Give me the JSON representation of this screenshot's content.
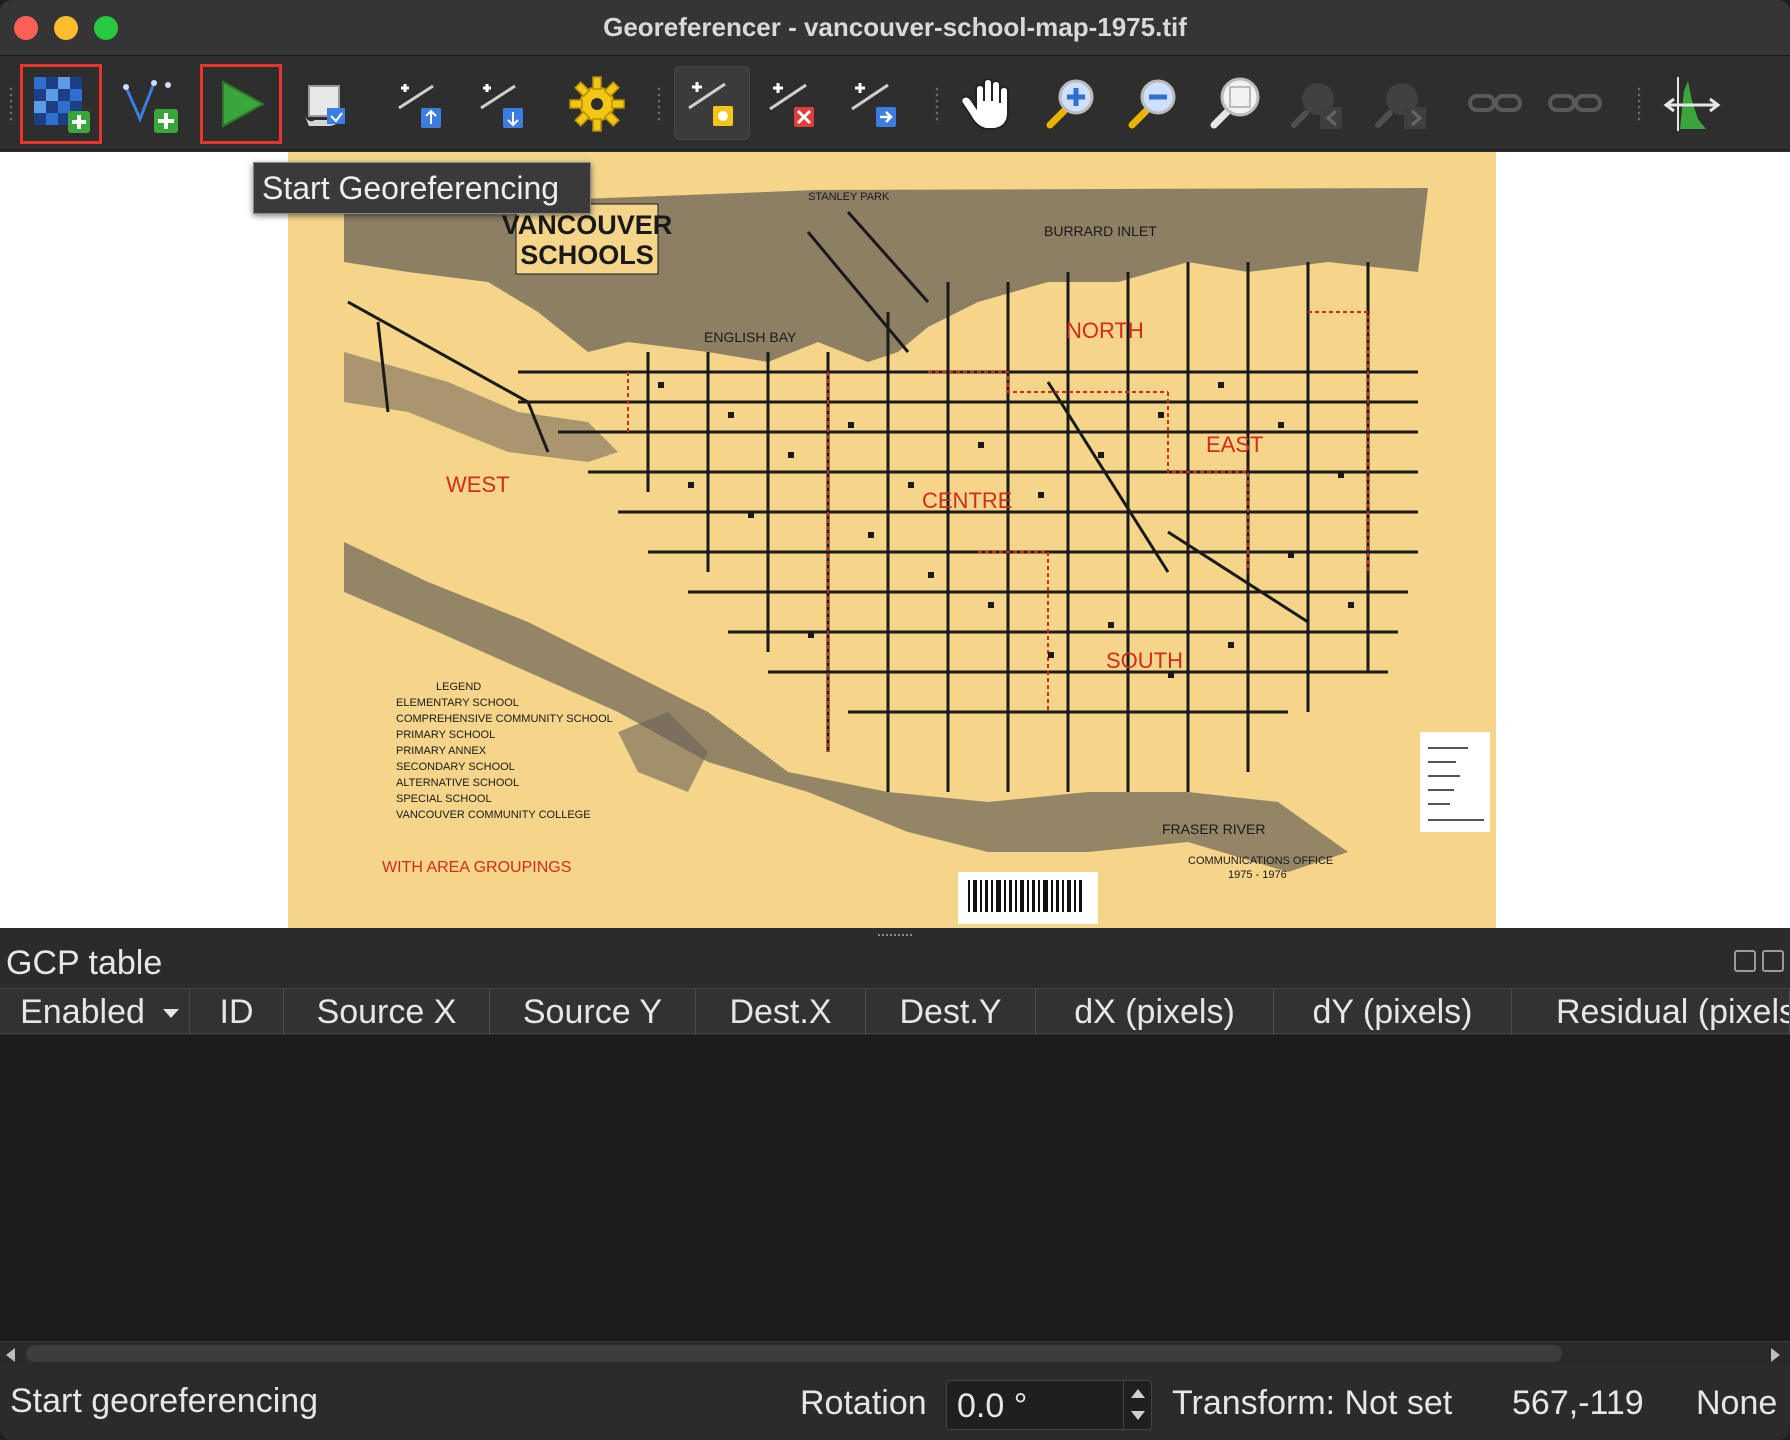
{
  "window": {
    "title": "Georeferencer - vancouver-school-map-1975.tif"
  },
  "toolbar": {
    "buttons": [
      {
        "name": "open-raster",
        "icon": "open-raster-icon",
        "highlighted": true
      },
      {
        "name": "add-vector",
        "icon": "add-vector-icon"
      },
      {
        "name": "start-georeferencing",
        "icon": "play-icon",
        "highlighted": true
      },
      {
        "name": "generate-gdal-script",
        "icon": "script-icon"
      },
      {
        "name": "load-gcp-points",
        "icon": "load-gcp-icon"
      },
      {
        "name": "save-gcp-points",
        "icon": "save-gcp-icon"
      },
      {
        "name": "transformation-settings",
        "icon": "gear-icon"
      },
      {
        "name": "add-point",
        "icon": "add-point-icon",
        "pressed": true
      },
      {
        "name": "delete-point",
        "icon": "delete-point-icon"
      },
      {
        "name": "move-gcp-point",
        "icon": "move-point-icon"
      },
      {
        "name": "pan",
        "icon": "pan-hand-icon"
      },
      {
        "name": "zoom-in",
        "icon": "zoom-in-icon"
      },
      {
        "name": "zoom-out",
        "icon": "zoom-out-icon"
      },
      {
        "name": "zoom-to-layer",
        "icon": "zoom-layer-icon"
      },
      {
        "name": "zoom-last",
        "icon": "zoom-last-icon",
        "disabled": true
      },
      {
        "name": "zoom-next",
        "icon": "zoom-next-icon",
        "disabled": true
      },
      {
        "name": "link-georeferencer-to-qgis",
        "icon": "link-icon",
        "disabled": true
      },
      {
        "name": "link-qgis-to-georeferencer",
        "icon": "link-icon",
        "disabled": true
      },
      {
        "name": "full-histogram-stretch",
        "icon": "histogram-stretch-icon"
      }
    ]
  },
  "tooltip": {
    "text": "Start Georeferencing"
  },
  "map": {
    "title_line1": "VANCOUVER",
    "title_line2": "SCHOOLS",
    "areas": [
      "NORTH",
      "EAST",
      "WEST",
      "CENTRE",
      "SOUTH"
    ],
    "places": [
      "BURRARD INLET",
      "ENGLISH BAY",
      "FRASER RIVER",
      "STANLEY PARK"
    ],
    "legend_title": "LEGEND",
    "legend_items": [
      "ELEMENTARY SCHOOL",
      "COMPREHENSIVE COMMUNITY SCHOOL",
      "PRIMARY SCHOOL",
      "PRIMARY ANNEX",
      "SECONDARY SCHOOL",
      "ALTERNATIVE SCHOOL",
      "SPECIAL SCHOOL",
      "VANCOUVER COMMUNITY COLLEGE"
    ],
    "groupings": "WITH AREA GROUPINGS",
    "office": "COMMUNICATIONS OFFICE",
    "years": "1975 - 1976",
    "colors": {
      "paper": "#f4d58a",
      "ink": "#1a1a1a",
      "red": "#d42a1e",
      "water": "#6b6257"
    }
  },
  "gcp_panel": {
    "title": "GCP table",
    "columns": [
      "Enabled",
      "ID",
      "Source X",
      "Source Y",
      "Dest.X",
      "Dest.Y",
      "dX (pixels)",
      "dY (pixels)",
      "Residual (pixels)"
    ],
    "rows": []
  },
  "status": {
    "message": "Start georeferencing",
    "rotation_label": "Rotation",
    "rotation_value": "0.0 °",
    "transform": "Transform: Not set",
    "coords": "567,-119",
    "crs": "None"
  }
}
